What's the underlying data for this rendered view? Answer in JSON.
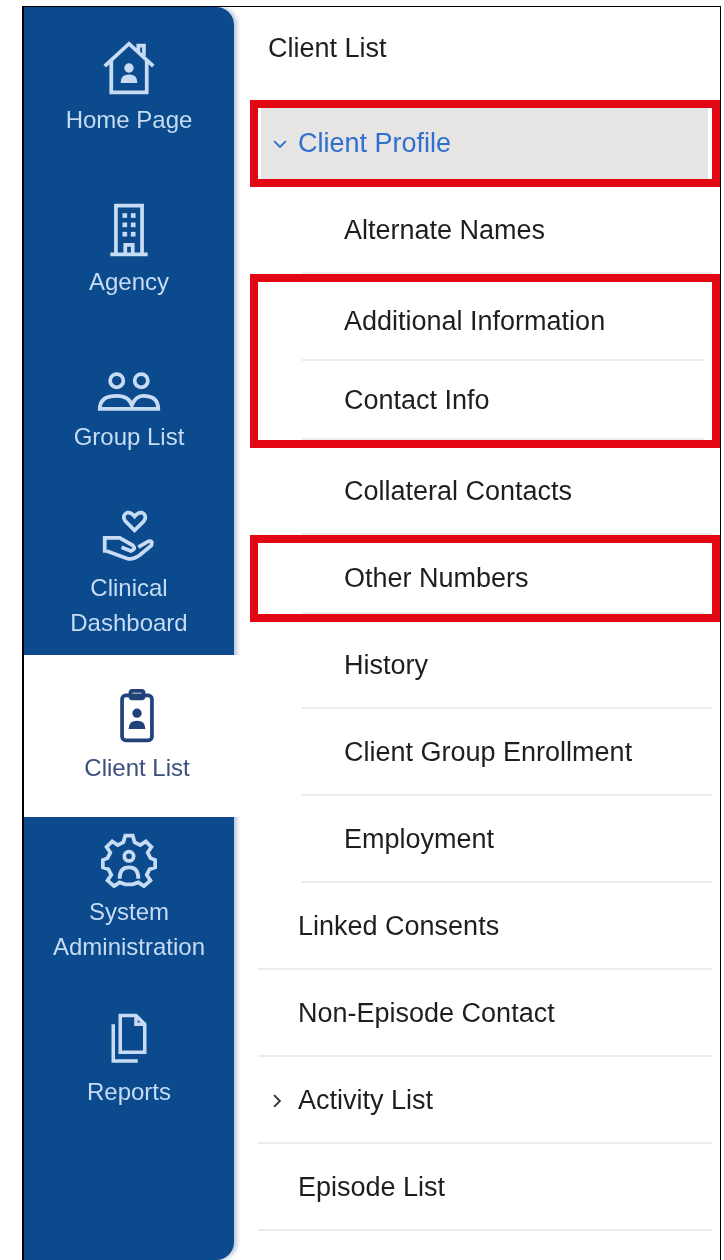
{
  "sidebar": {
    "items": [
      {
        "label": "Home Page",
        "kind": "house",
        "selected": false
      },
      {
        "label": "Agency",
        "kind": "building",
        "selected": false
      },
      {
        "label": "Group List",
        "kind": "people",
        "selected": false
      },
      {
        "label": "Clinical Dashboard",
        "kind": "care",
        "selected": false
      },
      {
        "label": "Client List",
        "kind": "clipboard",
        "selected": true
      },
      {
        "label": "System Administration",
        "kind": "gear",
        "selected": false
      },
      {
        "label": "Reports",
        "kind": "pages",
        "selected": false
      }
    ]
  },
  "menu": {
    "title": "Client List",
    "items": [
      {
        "label": "Client Profile",
        "kind": "group",
        "expanded": true,
        "selected": true,
        "highlighted": true,
        "children": [
          {
            "label": "Alternate Names",
            "selected": false,
            "highlighted": false
          },
          {
            "label": "Additional Information",
            "selected": false,
            "highlighted": true
          },
          {
            "label": "Contact Info",
            "selected": false,
            "highlighted": true
          },
          {
            "label": "Collateral Contacts",
            "selected": false,
            "highlighted": false
          },
          {
            "label": "Other Numbers",
            "selected": false,
            "highlighted": true
          },
          {
            "label": "History",
            "selected": false,
            "highlighted": false
          },
          {
            "label": "Client Group Enrollment",
            "selected": false,
            "highlighted": false
          },
          {
            "label": "Employment",
            "selected": false,
            "highlighted": false
          }
        ]
      },
      {
        "label": "Linked Consents",
        "kind": "link",
        "selected": false,
        "highlighted": false
      },
      {
        "label": "Non-Episode Contact",
        "kind": "link",
        "selected": false,
        "highlighted": false
      },
      {
        "label": "Activity List",
        "kind": "group",
        "expanded": false,
        "selected": false,
        "highlighted": false
      },
      {
        "label": "Episode List",
        "kind": "link",
        "selected": false,
        "highlighted": false
      }
    ]
  }
}
